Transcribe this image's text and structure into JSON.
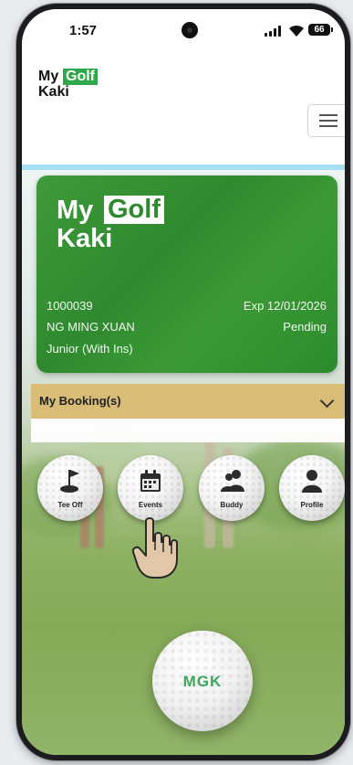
{
  "status_bar": {
    "time": "1:57",
    "battery": "66"
  },
  "app": {
    "logo_my": "My",
    "logo_golf": "Golf",
    "logo_kaki": "Kaki"
  },
  "card": {
    "logo_my": "My",
    "logo_golf": "Golf",
    "logo_kaki": "Kaki",
    "member_id": "1000039",
    "expiry": "Exp 12/01/2026",
    "name": "NG MING XUAN",
    "status": "Pending",
    "membership_type": "Junior (With Ins)"
  },
  "booking": {
    "title": "My Booking(s)"
  },
  "actions": [
    {
      "label": "Tee Off",
      "icon": "golf-flag-icon"
    },
    {
      "label": "Events",
      "icon": "calendar-icon"
    },
    {
      "label": "Buddy",
      "icon": "users-icon"
    },
    {
      "label": "Profile",
      "icon": "person-icon"
    }
  ],
  "ball_logo": "MGK",
  "colors": {
    "brand_green": "#2f8a2f",
    "booking_gold": "#d9bd77",
    "accent_blue": "#a6dff0"
  }
}
